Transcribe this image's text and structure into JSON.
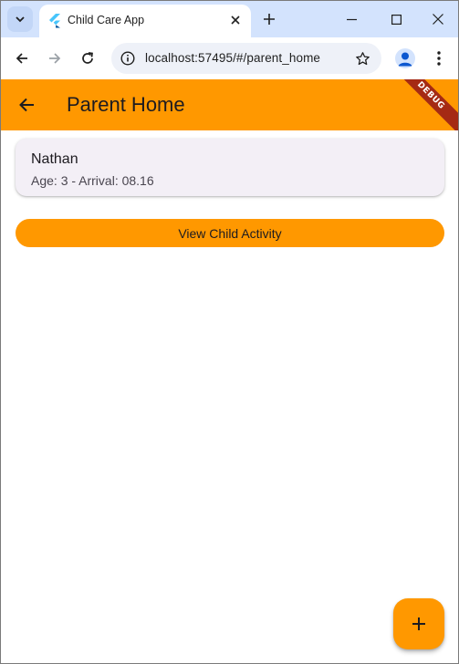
{
  "browser": {
    "tab": {
      "title": "Child Care App"
    },
    "address_bar": {
      "url": "localhost:57495/#/parent_home"
    }
  },
  "app": {
    "appbar": {
      "title": "Parent Home"
    },
    "debug_banner": "DEBUG",
    "children": [
      {
        "name": "Nathan",
        "details": "Age: 3 - Arrival: 08.16"
      }
    ],
    "view_activity_label": "View Child Activity"
  },
  "icons": {
    "tab_list": "chevron-down-icon",
    "favicon": "flutter-icon",
    "tab_close": "close-icon",
    "new_tab": "plus-icon",
    "minimize": "minimize-icon",
    "maximize": "maximize-icon",
    "close_window": "close-icon",
    "back": "arrow-left-icon",
    "forward": "arrow-right-icon",
    "reload": "reload-icon",
    "site_info": "info-icon",
    "bookmark": "star-icon",
    "profile": "person-icon",
    "menu": "kebab-menu-icon",
    "appbar_back": "arrow-left-icon",
    "fab": "plus-icon"
  },
  "colors": {
    "primary": "#ff9800",
    "tabstrip": "#d3e3fd",
    "card": "#f3eff6",
    "debug_banner": "#a52a14"
  }
}
